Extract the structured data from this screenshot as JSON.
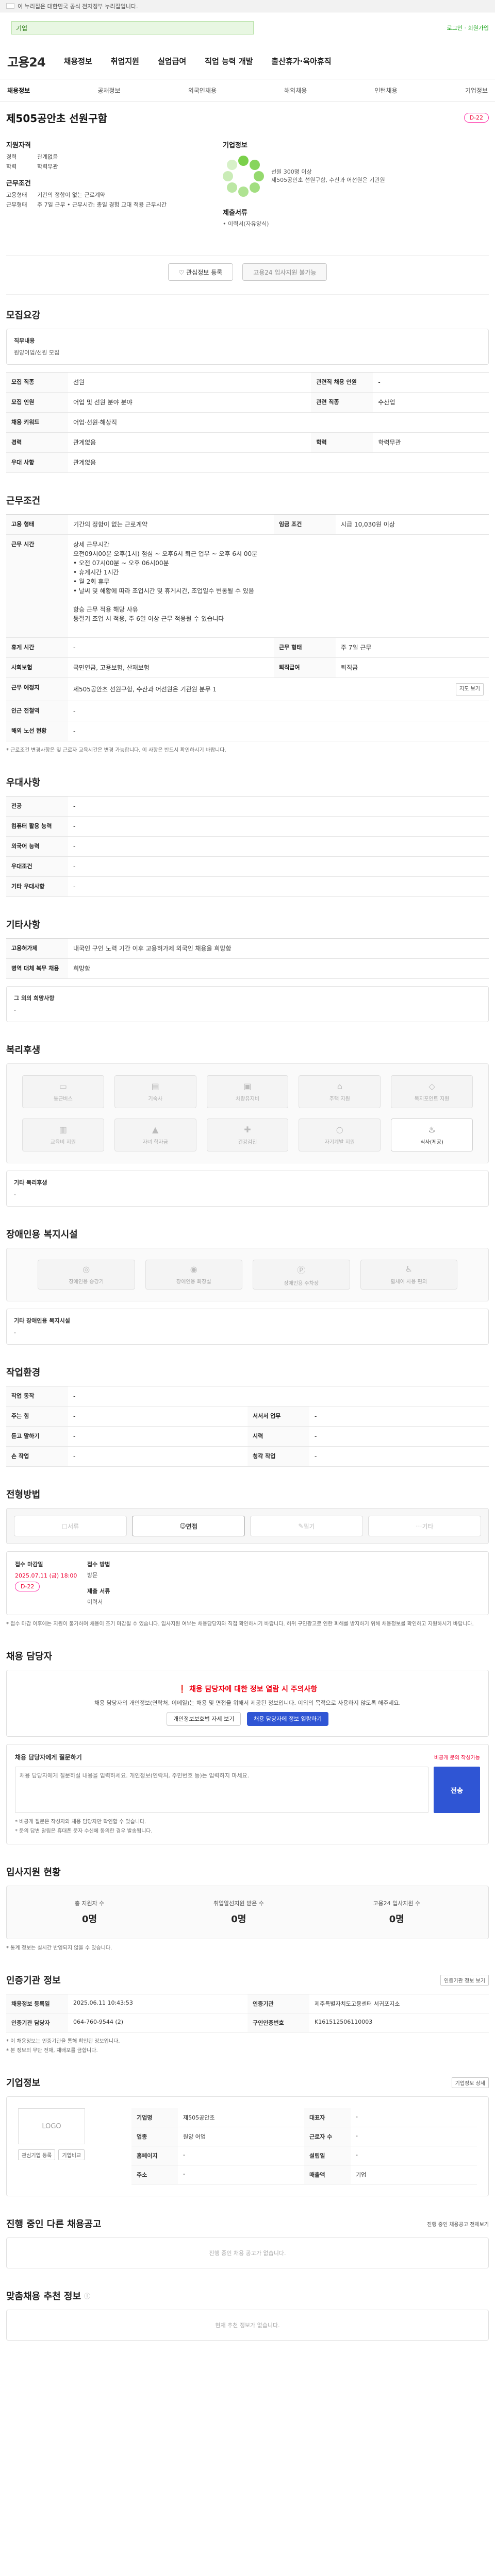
{
  "gov": {
    "notice": "이 누리집은 대한민국 공식 전자정부 누리집입니다."
  },
  "top": {
    "search_placeholder": "기업",
    "links": "로그인 · 회원가입"
  },
  "header": {
    "logo": "고용24",
    "gnb": [
      "채용정보",
      "취업지원",
      "실업급여",
      "직업 능력 개발",
      "출산휴가·육아휴직"
    ]
  },
  "subnav": [
    "채용정보",
    "공채정보",
    "외국인채용",
    "해외채용",
    "인턴채용",
    "기업정보"
  ],
  "job": {
    "title": "제505공안초 선원구함",
    "badge": "D-22",
    "summary": {
      "experience_label": "지원자격",
      "experience_k1": "경력",
      "experience_v1": "관계없음",
      "experience_k2": "학력",
      "experience_v2": "학력무관",
      "condition_label": "근무조건",
      "cond_k1": "고용형태",
      "cond_v1": "기간의 정함이 없는 근로계약",
      "cond_k2": "근무형태",
      "cond_v2": "주 7일 근무 • 근무시간: 총일 경험 교대 적용 근무시간",
      "company_label": "기업정보",
      "company_line1": "선원 300명 이상",
      "company_line2": "제505공안초 선원구함, 수산과 어선원은 기관원",
      "apply_label": "제출서류",
      "apply_v": "• 이력서(자유양식)"
    },
    "actions": {
      "fav": "관심정보 등록",
      "apply": "고용24 입사지원 불가능"
    }
  },
  "recruit": {
    "h": "모집요강",
    "job_label": "직무내용",
    "job_value": "원양어업/선원 모집",
    "rows": [
      [
        "모집 직종",
        "선원",
        "관련직 채용 인원",
        "-"
      ],
      [
        "모집 인원",
        "어업 및 선원 분야 분야",
        "관련 직종",
        "수산업"
      ],
      [
        "채용 키워드",
        "어업·선원·해상직"
      ],
      [
        "경력",
        "관계없음",
        "학력",
        "학력무관"
      ],
      [
        "우대 사항",
        "관계없음"
      ]
    ]
  },
  "work": {
    "h": "근무조건",
    "rows": [
      [
        "고용 형태",
        "기간의 정함이 없는 근로계약",
        "임금 조건",
        "시급 10,030원 이상"
      ],
      [
        "근무 시간",
        "상세 근무시간\n오전09시00분 오후(1시) 점심 ~ 오후6시 퇴근 업무 ~ 오후 6시 00분\n• 오전 07시00분 ~ 오후 06시00분\n• 휴게시간 1시간\n• 월 2회 휴무\n• 날씨 및 해황에 따라 조업시간 및 휴게시간, 조업일수 변동될 수 있음\n\n항승 근무 적용 해당 사유\n동절기 조업 시 적용, 주 6일 이상 근무 적용될 수 있습니다"
      ],
      [
        "휴게 시간",
        "-",
        "근무 형태",
        "주 7일 근무"
      ],
      [
        "사회보험",
        "국민연금, 고용보험, 산재보험",
        "퇴직급여",
        "퇴직금"
      ],
      [
        "근무 예정지",
        "제505공안초 선원구함, 수산과 어선원은 기관원 분무 1"
      ],
      [
        "인근 전철역",
        "-"
      ],
      [
        "해외 노선 현황",
        "-"
      ]
    ],
    "map_button": "지도 보기",
    "footnote": "* 근로조건 변경사항은 및 근로자 교육시간은 변경 가능합니다. 이 사항은 반드시 확인하시기 바랍니다."
  },
  "pref": {
    "h": "우대사항",
    "rows": [
      [
        "전공",
        "-"
      ],
      [
        "컴퓨터 활용 능력",
        "-"
      ],
      [
        "외국어 능력",
        "-"
      ],
      [
        "우대조건",
        "-"
      ],
      [
        "기타 우대사항",
        "-"
      ]
    ]
  },
  "etc": {
    "h": "기타사항",
    "rows": [
      [
        "고용허가제",
        "내국인 구인 노력 기간 이후 고용허가제 외국인 채용을 희망함"
      ],
      [
        "병역 대체 복무 채용",
        "희망함"
      ]
    ],
    "misc_label": "그 외의 희망사항",
    "misc_value": "-"
  },
  "welfare": {
    "h": "복리후생",
    "items": [
      "통근버스",
      "기숙사",
      "차량유지비",
      "주택 지원",
      "복지포인트 지원",
      "교육비 지원",
      "자녀 학자금",
      "건강검진",
      "자기계발 지원",
      "식사(제공)"
    ],
    "extra_label": "기타 복리후생",
    "extra_value": "-"
  },
  "disabled": {
    "h": "장애인용 복지시설",
    "items": [
      "장애인용 승강기",
      "장애인용 화장실",
      "장애인용 주차장",
      "휠체어 사용 편의"
    ],
    "extra_label": "기타 장애인용 복지시설",
    "extra_value": "-"
  },
  "env": {
    "h": "작업환경",
    "rows": [
      [
        "작업 동작",
        "-"
      ],
      [
        "주는 힘",
        "-",
        "서서서 업무",
        "-"
      ],
      [
        "듣고 말하기",
        "-",
        "시력",
        "-"
      ],
      [
        "손 작업",
        "-",
        "청각 작업",
        "-"
      ]
    ]
  },
  "process": {
    "h": "전형방법",
    "steps": [
      "서류",
      "면접",
      "필기",
      "기타"
    ],
    "active": 1,
    "k1": "접수 마감일",
    "v1": "2025.07.11 (금) 18:00",
    "badge": "D-22",
    "k2": "접수 방법",
    "v2": "방문",
    "k3": "제출 서류",
    "v3": "이력서",
    "notice": "* 접수 마감 이후에는 지원이 불가하며 채용이 조기 마감될 수 있습니다. 입사지원 여부는 채용담당자와 직접 확인하시기 바랍니다. 허위 구인광고로 인한 피해를 방지하기 위해 채용정보를 확인하고 지원하시기 바랍니다."
  },
  "contact": {
    "h": "채용 담당자",
    "alert_title": "채용 담당자에 대한 정보 열람 시 주의사항",
    "alert_body": "채용 담당자의 개인정보(연락처, 이메일)는 채용 및 면접을 위해서 제공된 정보입니다. 이외의 목적으로 사용하지 않도록 해주세요.",
    "btn1": "개인정보보호법 자세 보기",
    "btn2": "채용 담당자에 정보 열람하기",
    "q_title": "채용 담당자에게 질문하기",
    "q_note": "비공개 문의 작성가능",
    "q_placeholder": "채용 담당자에게 질문하실 내용을 입력하세요. 개인정보(연락처, 주민번호 등)는 입력하지 마세요.",
    "q_send": "전송",
    "q_foot1": "* 비공개 질문은 작성자와 채용 담당자만 확인할 수 있습니다.",
    "q_foot2": "* 문의 답변 알림은 휴대폰 문자 수신에 동의한 경우 발송됩니다."
  },
  "stats": {
    "h": "입사지원 현황",
    "items": [
      [
        "총 지원자 수",
        "0명"
      ],
      [
        "취업알선지원 받은 수",
        "0명"
      ],
      [
        "고용24 입사지원 수",
        "0명"
      ]
    ],
    "note": "* 통계 정보는 실시간 반영되지 않을 수 있습니다."
  },
  "org": {
    "h": "인증기관 정보",
    "btn": "인증기관 정보 보기",
    "rows": [
      [
        "채용정보 등록일",
        "2025.06.11 10:43:53",
        "인증기관",
        "제주특별자치도고용센터 서귀포지소"
      ],
      [
        "인증기관 담당자",
        "064-760-9544 (2)",
        "구인인증번호",
        "K161512506110003"
      ]
    ],
    "notes": [
      "* 이 채용정보는 인증기관을 통해 확인된 정보입니다.",
      "* 본 정보의 무단 전재, 재배포를 금합니다."
    ]
  },
  "company": {
    "h": "기업정보",
    "btn": "기업정보 상세",
    "logo": "LOGO",
    "fav": "관심기업 등록",
    "cmp": "기업비교",
    "info": [
      [
        "기업명",
        "제505공안초",
        "대표자",
        "-"
      ],
      [
        "업종",
        "원양 어업",
        "근로자 수",
        "-"
      ],
      [
        "홈페이지",
        "-",
        "설립일",
        "-"
      ],
      [
        "주소",
        "-",
        "매출액",
        "기업"
      ]
    ]
  },
  "others": {
    "h": "진행 중인 다른 채용공고",
    "btn": "진행 중인 채용공고 전체보기",
    "empty": "진행 중인 채용 공고가 없습니다."
  },
  "recommend": {
    "h": "맞춤채용 추천 정보",
    "empty": "현재 추천 정보가 없습니다."
  }
}
